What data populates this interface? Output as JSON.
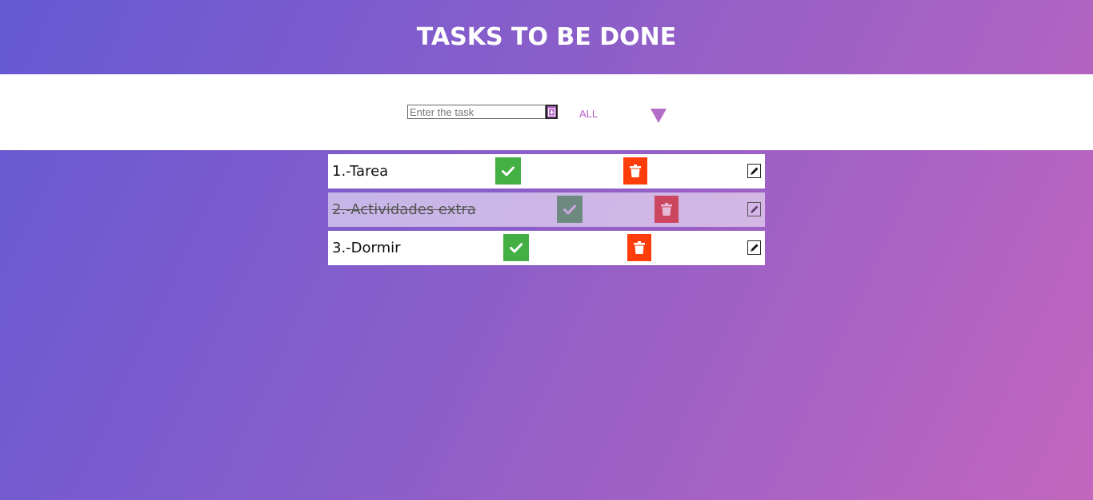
{
  "header": {
    "title": "TASKS TO BE DONE"
  },
  "toolbar": {
    "input_placeholder": "Enter the task",
    "input_value": "",
    "add_icon": "plus-square-icon",
    "filter_label": "ALL",
    "filter_icon": "triangle-down-icon"
  },
  "tasks": [
    {
      "text": "1.-Tarea",
      "done": false,
      "check_icon": "check-icon",
      "delete_icon": "trash-icon",
      "edit_icon": "pencil-icon"
    },
    {
      "text": "2.-Actividades extra",
      "done": true,
      "check_icon": "check-icon",
      "delete_icon": "trash-icon",
      "edit_icon": "pencil-icon"
    },
    {
      "text": "3.-Dormir",
      "done": false,
      "check_icon": "check-icon",
      "delete_icon": "trash-icon",
      "edit_icon": "pencil-icon"
    }
  ],
  "colors": {
    "gradient_start": "#6559d4",
    "gradient_end": "#c266be",
    "accent": "#b45ec8",
    "check_green": "#44b044",
    "delete_red": "#ff3d0a"
  }
}
